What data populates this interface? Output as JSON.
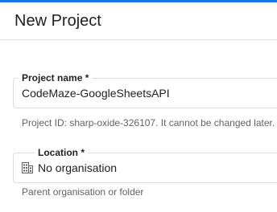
{
  "dialog": {
    "title": "New Project"
  },
  "project_name": {
    "label": "Project name *",
    "value": "CodeMaze-GoogleSheetsAPI",
    "helper": "Project ID: sharp-oxide-326107. It cannot be changed later."
  },
  "location": {
    "label": "Location *",
    "value": "No organisation",
    "icon": "organisation-icon",
    "helper": "Parent organisation or folder"
  },
  "colors": {
    "accent": "#1a73e8",
    "border": "#dadce0",
    "text": "#202124",
    "helper_text": "#5f6368"
  }
}
